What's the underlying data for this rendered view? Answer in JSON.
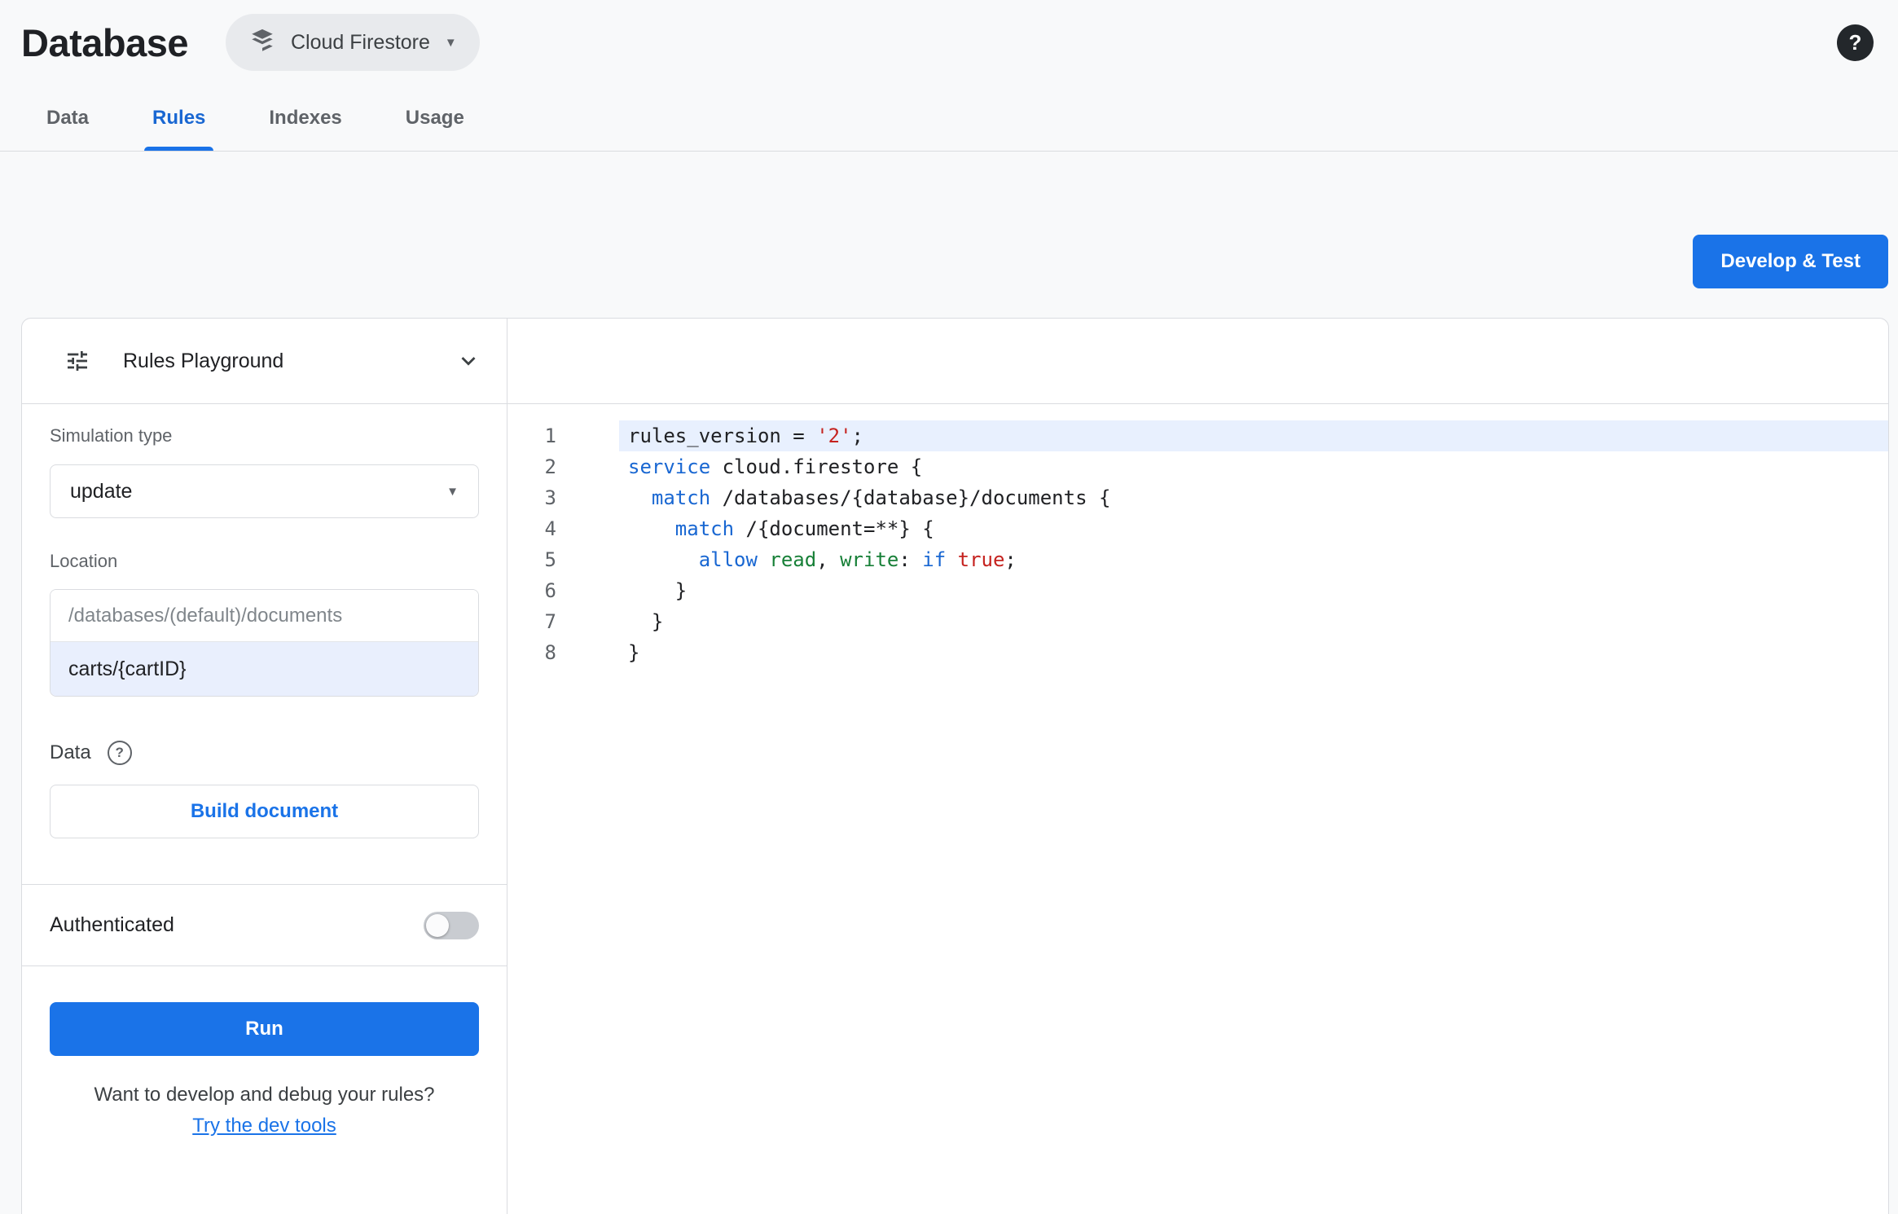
{
  "header": {
    "title": "Database",
    "product_selector": {
      "label": "Cloud Firestore"
    }
  },
  "icons": {
    "caret_down": "▼",
    "help": "?"
  },
  "tabs": [
    {
      "label": "Data",
      "active": false
    },
    {
      "label": "Rules",
      "active": true
    },
    {
      "label": "Indexes",
      "active": false
    },
    {
      "label": "Usage",
      "active": false
    }
  ],
  "actions": {
    "develop_test": "Develop & Test"
  },
  "playground": {
    "title": "Rules Playground",
    "simulation_type_label": "Simulation type",
    "simulation_type_value": "update",
    "location_label": "Location",
    "location_placeholder": "/databases/(default)/documents",
    "location_value": "carts/{cartID}",
    "data_label": "Data",
    "build_document": "Build document",
    "authenticated_label": "Authenticated",
    "authenticated_enabled": false,
    "run": "Run",
    "footer_text": "Want to develop and debug your rules?",
    "footer_link": "Try the dev tools"
  },
  "editor": {
    "active_line": 1,
    "lines": [
      {
        "num": 1,
        "tokens": [
          {
            "t": "rules_version = ",
            "c": "plain"
          },
          {
            "t": "'2'",
            "c": "str"
          },
          {
            "t": ";",
            "c": "plain"
          }
        ]
      },
      {
        "num": 2,
        "tokens": [
          {
            "t": "service",
            "c": "kw"
          },
          {
            "t": " cloud.firestore {",
            "c": "plain"
          }
        ]
      },
      {
        "num": 3,
        "tokens": [
          {
            "t": "  ",
            "c": "plain"
          },
          {
            "t": "match",
            "c": "kw"
          },
          {
            "t": " /databases/{database}/documents {",
            "c": "plain"
          }
        ]
      },
      {
        "num": 4,
        "tokens": [
          {
            "t": "    ",
            "c": "plain"
          },
          {
            "t": "match",
            "c": "kw"
          },
          {
            "t": " /{document=**} {",
            "c": "plain"
          }
        ]
      },
      {
        "num": 5,
        "tokens": [
          {
            "t": "      ",
            "c": "plain"
          },
          {
            "t": "allow",
            "c": "kw"
          },
          {
            "t": " ",
            "c": "plain"
          },
          {
            "t": "read",
            "c": "perm"
          },
          {
            "t": ", ",
            "c": "plain"
          },
          {
            "t": "write",
            "c": "perm"
          },
          {
            "t": ": ",
            "c": "plain"
          },
          {
            "t": "if",
            "c": "kw"
          },
          {
            "t": " ",
            "c": "plain"
          },
          {
            "t": "true",
            "c": "bool"
          },
          {
            "t": ";",
            "c": "plain"
          }
        ]
      },
      {
        "num": 6,
        "tokens": [
          {
            "t": "    }",
            "c": "plain"
          }
        ]
      },
      {
        "num": 7,
        "tokens": [
          {
            "t": "  }",
            "c": "plain"
          }
        ]
      },
      {
        "num": 8,
        "tokens": [
          {
            "t": "}",
            "c": "plain"
          }
        ]
      }
    ]
  },
  "colors": {
    "accent": "#1a73e8",
    "tab_active": "#1967d2",
    "keyword": "#1967d2",
    "string": "#c5221f",
    "permission": "#188038",
    "active_line_bg": "#e8f0fe"
  }
}
